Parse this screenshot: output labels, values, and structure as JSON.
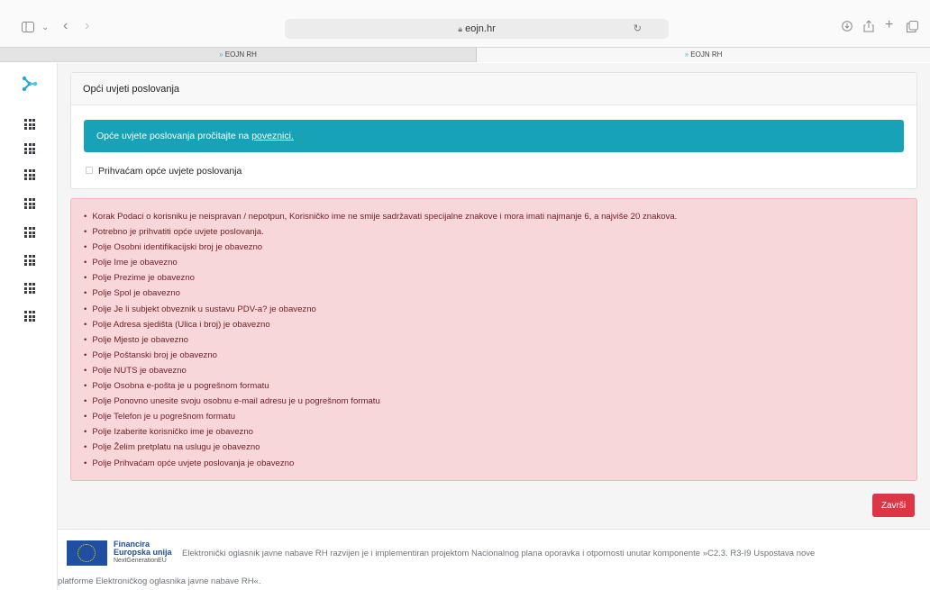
{
  "browser": {
    "url": "eojn.hr",
    "tabs": [
      {
        "label": "EOJN RH",
        "active": false
      },
      {
        "label": "EOJN RH",
        "active": true
      }
    ]
  },
  "sidebar": {
    "items": [
      "grid-icon",
      "grid-icon",
      "grid-icon",
      "grid-icon",
      "grid-icon",
      "grid-icon",
      "grid-icon",
      "grid-icon"
    ]
  },
  "card": {
    "title": "Opći uvjeti poslovanja",
    "info_text": "Opće uvjete poslovanja pročitajte na",
    "info_link": "poveznici.",
    "checkbox_label": "Prihvaćam opće uvjete poslovanja",
    "checkbox_checked": false
  },
  "errors": [
    "Korak Podaci o korisniku je neispravan / nepotpun, Korisničko ime ne smije sadržavati specijalne znakove i mora imati najmanje 6, a najviše 20 znakova.",
    "Potrebno je prihvatiti opće uvjete poslovanja.",
    "Polje Osobni identifikacijski broj je obavezno",
    "Polje Ime je obavezno",
    "Polje Prezime je obavezno",
    "Polje Spol je obavezno",
    "Polje Je li subjekt obveznik u sustavu PDV-a? je obavezno",
    "Polje Adresa sjedišta (Ulica i broj) je obavezno",
    "Polje Mjesto je obavezno",
    "Polje Poštanski broj je obavezno",
    "Polje NUTS je obavezno",
    "Polje Osobna e-pošta je u pogrešnom formatu",
    "Polje Ponovno unesite svoju osobnu e-mail adresu je u pogrešnom formatu",
    "Polje Telefon je u pogrešnom formatu",
    "Polje Izaberite korisničko ime je obavezno",
    "Polje Želim pretplatu na uslugu je obavezno",
    "Polje Prihvaćam opće uvjete poslovanja je obavezno"
  ],
  "actions": {
    "finish_label": "Završi"
  },
  "footer": {
    "funding_line1": "Financira",
    "funding_line2": "Europska unija",
    "funding_line3": "NextGenerationEU",
    "text_line1": "Elektronički oglasnik javne nabave RH razvijen je i implementiran projektom Nacionalnog plana oporavka i otpornosti unutar komponente »C2.3. R3-I9 Uspostava nove",
    "text_line2": "platforme Elektroničkog oglasnika javne nabave RH«."
  },
  "colors": {
    "info": "#17a2b8",
    "danger_bg": "#f8d7da",
    "danger_text": "#721c24",
    "button": "#dc3545"
  }
}
